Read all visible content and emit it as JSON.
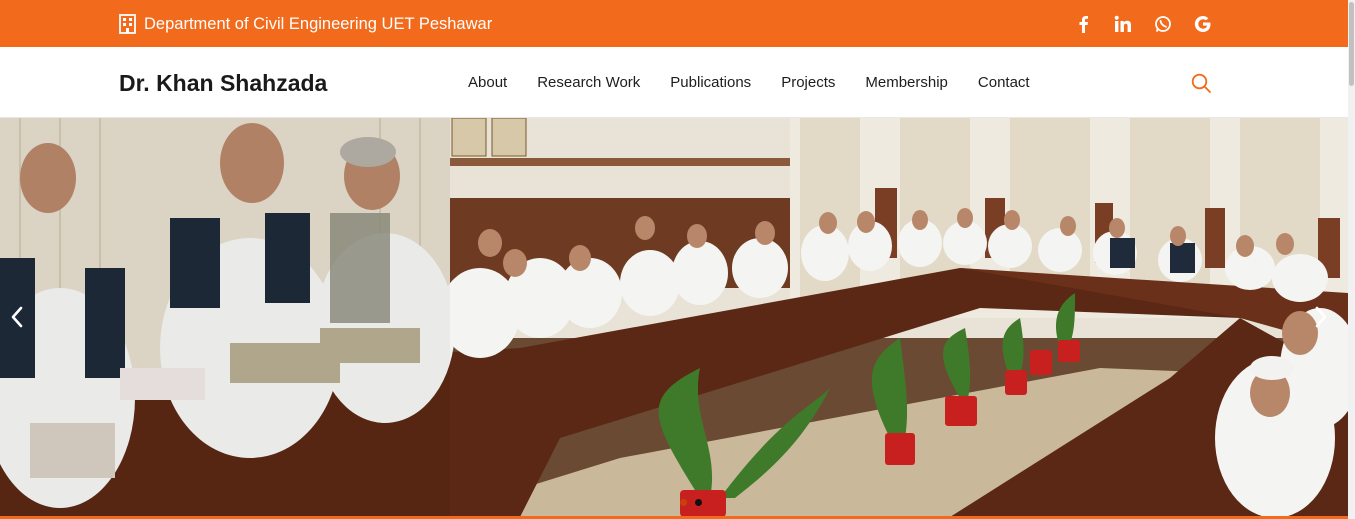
{
  "topbar": {
    "department": "Department of Civil Engineering UET Peshawar",
    "social_icons": [
      "facebook-icon",
      "linkedin-icon",
      "whatsapp-icon",
      "google-icon"
    ]
  },
  "navbar": {
    "brand": "Dr. Khan Shahzada",
    "menu": [
      "About",
      "Research Work",
      "Publications",
      "Projects",
      "Membership",
      "Contact"
    ],
    "search_icon": "search-icon"
  },
  "hero": {
    "image_alt": "",
    "slides": 2,
    "active_slide": 1
  },
  "colors": {
    "accent": "#f26a1b",
    "text": "#1e1e1e",
    "brand_text": "#1a1a1a"
  }
}
